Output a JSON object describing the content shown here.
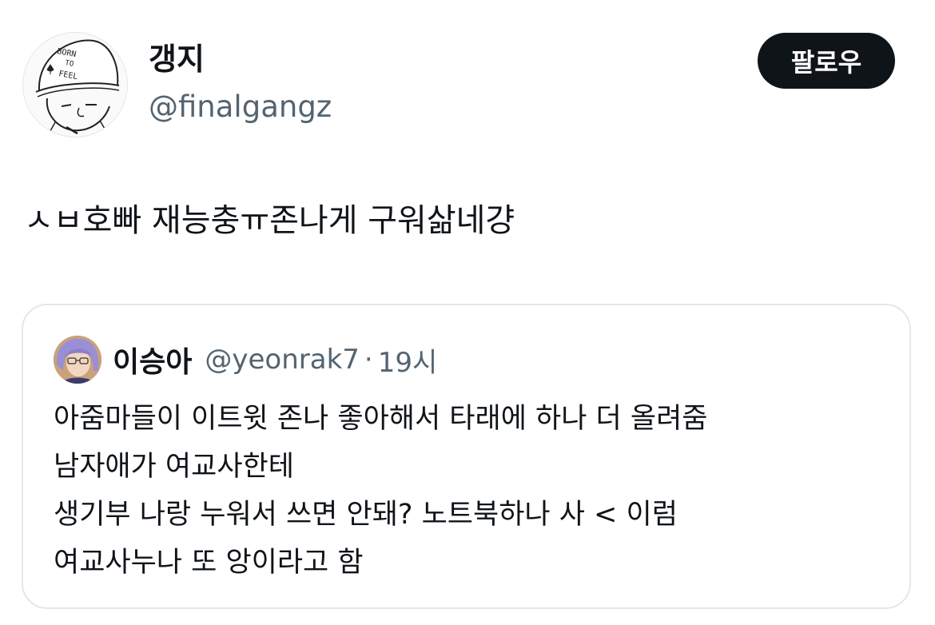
{
  "author": {
    "display_name": "갱지",
    "handle": "@finalgangz",
    "avatar_text": "BORN TO FEEL",
    "follow_label": "팔로우"
  },
  "tweet": {
    "text": "ㅅㅂ호빠 재능충ㅠ존나게 구워삶네걍"
  },
  "quote": {
    "author_name": "이승아",
    "author_handle": "@yeonrak7",
    "separator": "·",
    "time": "19시",
    "lines": [
      "아줌마들이 이트윗 존나 좋아해서 타래에 하나 더 올려줌",
      "남자애가 여교사한테",
      "생기부 나랑 누워서 쓰면 안돼? 노트북하나 사 < 이럼",
      "여교사누나 또 앙이라고 함"
    ]
  },
  "colors": {
    "text_primary": "#0f1419",
    "text_secondary": "#536471",
    "button_bg": "#0f1419",
    "card_border": "#e1e8ed"
  }
}
